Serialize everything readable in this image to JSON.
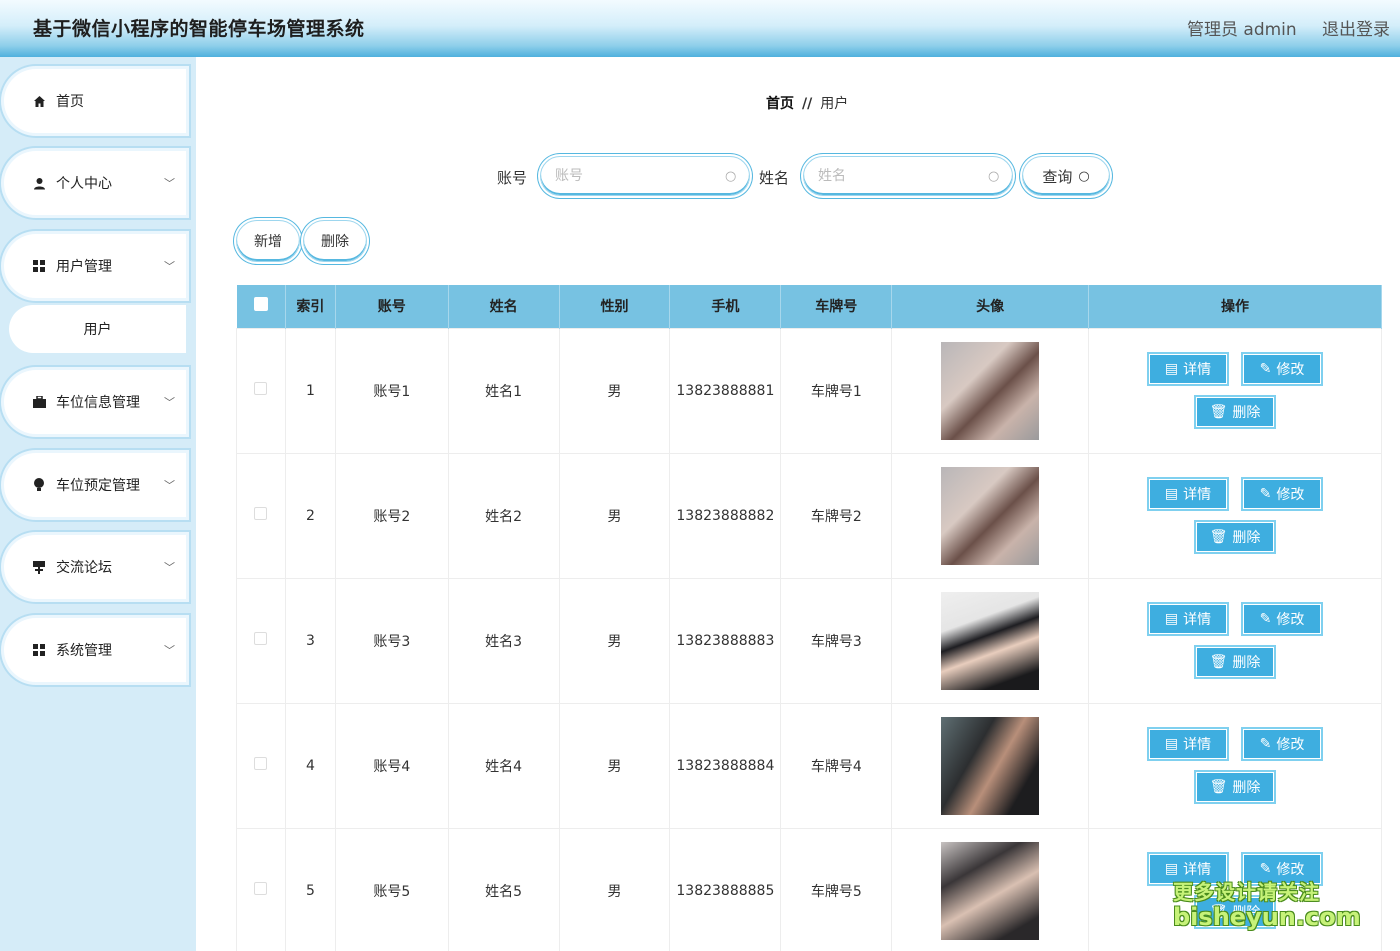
{
  "header": {
    "title": "基于微信小程序的智能停车场管理系统",
    "user": "管理员 admin",
    "logout": "退出登录"
  },
  "sidebar": {
    "items": [
      {
        "label": "首页",
        "icon": "home-icon"
      },
      {
        "label": "个人中心",
        "icon": "user-icon"
      },
      {
        "label": "用户管理",
        "icon": "grid-icon"
      },
      {
        "label": "车位信息管理",
        "icon": "briefcase-icon"
      },
      {
        "label": "车位预定管理",
        "icon": "bulb-icon"
      },
      {
        "label": "交流论坛",
        "icon": "flag-icon"
      },
      {
        "label": "系统管理",
        "icon": "grid-icon"
      }
    ],
    "sub_item": "用户"
  },
  "breadcrumb": {
    "home": "首页",
    "sep": "//",
    "current": "用户"
  },
  "search": {
    "account_label": "账号",
    "account_placeholder": "账号",
    "name_label": "姓名",
    "name_placeholder": "姓名",
    "query": "查询"
  },
  "actions": {
    "add": "新增",
    "delete": "删除"
  },
  "table": {
    "headers": [
      "索引",
      "账号",
      "姓名",
      "性别",
      "手机",
      "车牌号",
      "头像",
      "操作"
    ],
    "rows": [
      {
        "index": "1",
        "account": "账号1",
        "name": "姓名1",
        "gender": "男",
        "phone": "13823888881",
        "plate": "车牌号1"
      },
      {
        "index": "2",
        "account": "账号2",
        "name": "姓名2",
        "gender": "男",
        "phone": "13823888882",
        "plate": "车牌号2"
      },
      {
        "index": "3",
        "account": "账号3",
        "name": "姓名3",
        "gender": "男",
        "phone": "13823888883",
        "plate": "车牌号3"
      },
      {
        "index": "4",
        "account": "账号4",
        "name": "姓名4",
        "gender": "男",
        "phone": "13823888884",
        "plate": "车牌号4"
      },
      {
        "index": "5",
        "account": "账号5",
        "name": "姓名5",
        "gender": "男",
        "phone": "13823888885",
        "plate": "车牌号5"
      }
    ],
    "ops": {
      "detail": "详情",
      "edit": "修改",
      "delete": "删除"
    }
  },
  "watermark": {
    "line1": "更多设计请关注",
    "line2": "bisheyun.com"
  },
  "colors": {
    "accent": "#3eaee0",
    "header_bg": "#77c2e2",
    "sidebar_bg": "#d5ecf8"
  }
}
